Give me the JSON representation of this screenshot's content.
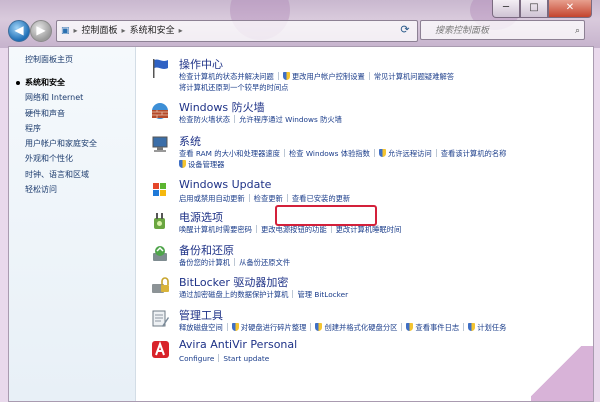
{
  "address": {
    "crumbs": [
      "控制面板",
      "系统和安全"
    ],
    "search_placeholder": "搜索控制面板"
  },
  "sidebar": {
    "home": "控制面板主页",
    "items": [
      "系统和安全",
      "网络和 Internet",
      "硬件和声音",
      "程序",
      "用户帐户和家庭安全",
      "外观和个性化",
      "时钟、语言和区域",
      "轻松访问"
    ]
  },
  "sections": [
    {
      "title": "操作中心",
      "links": [
        "检查计算机的状态并解决问题",
        "更改用户帐户控制设置",
        "常见计算机问题疑难解答",
        "将计算机还原到一个较早的时间点"
      ]
    },
    {
      "title": "Windows 防火墙",
      "links": [
        "检查防火墙状态",
        "允许程序通过 Windows 防火墙"
      ]
    },
    {
      "title": "系统",
      "links": [
        "查看 RAM 的大小和处理器速度",
        "检查 Windows 体验指数",
        "允许远程访问",
        "查看该计算机的名称",
        "设备管理器"
      ]
    },
    {
      "title": "Windows Update",
      "links": [
        "启用或禁用自动更新",
        "检查更新",
        "查看已安装的更新"
      ]
    },
    {
      "title": "电源选项",
      "links": [
        "唤醒计算机时需要密码",
        "更改电源按钮的功能",
        "更改计算机睡眠时间"
      ]
    },
    {
      "title": "备份和还原",
      "links": [
        "备份您的计算机",
        "从备份还原文件"
      ]
    },
    {
      "title": "BitLocker 驱动器加密",
      "links": [
        "通过加密磁盘上的数据保护计算机",
        "管理 BitLocker"
      ]
    },
    {
      "title": "管理工具",
      "links": [
        "释放磁盘空间",
        "对硬盘进行碎片整理",
        "创建并格式化硬盘分区",
        "查看事件日志",
        "计划任务"
      ]
    },
    {
      "title": "Avira AntiVir Personal",
      "links": [
        "Configure",
        "Start update"
      ]
    }
  ],
  "colors": {
    "link": "#1a3c8a",
    "title": "#1e3287",
    "highlight": "#d3203a"
  }
}
